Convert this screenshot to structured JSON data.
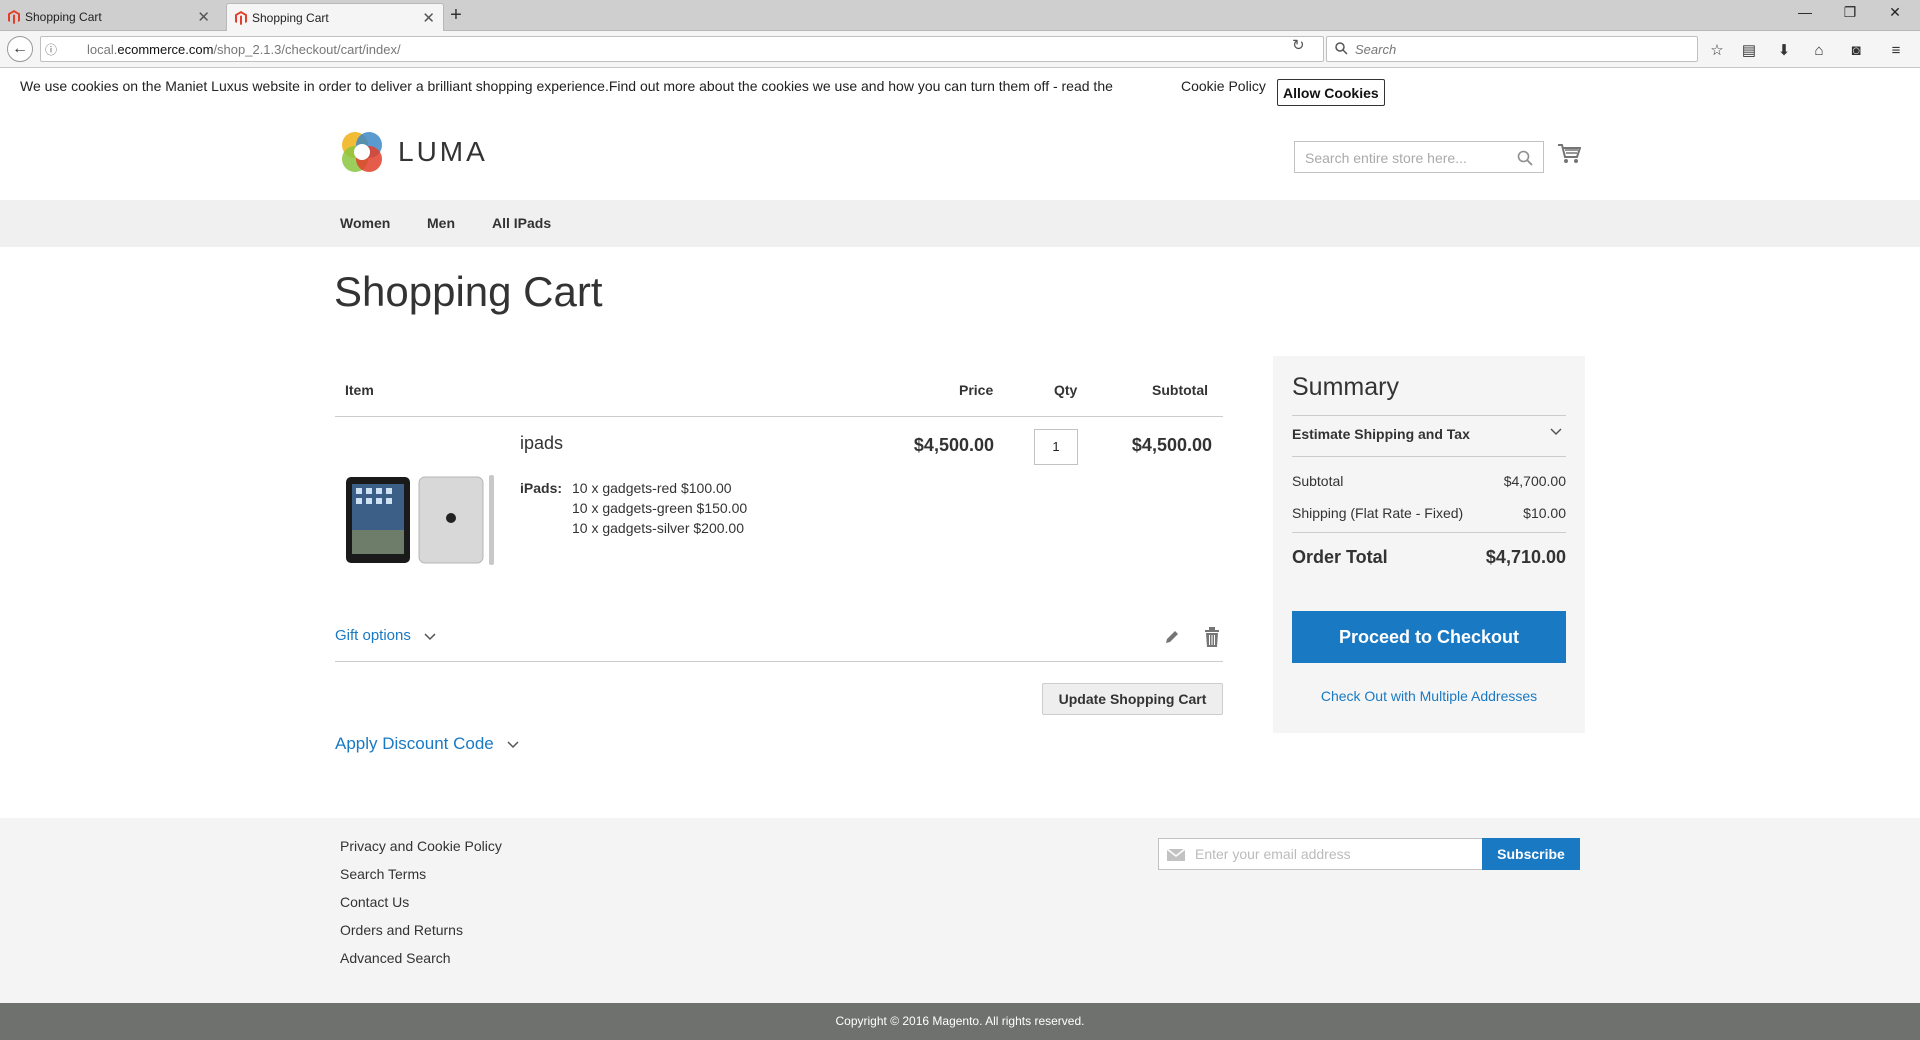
{
  "browser": {
    "tabs": [
      {
        "title": "Shopping Cart",
        "active": false
      },
      {
        "title": "Shopping Cart",
        "active": true
      }
    ],
    "url_prefix": "local.",
    "url_domain": "ecommerce.com",
    "url_path": "/shop_2.1.3/checkout/cart/index/",
    "search_placeholder": "Search"
  },
  "cookie": {
    "text": "We use cookies on the Maniet Luxus website in order to deliver a brilliant shopping experience.Find out more about the cookies we use and how you can turn them off - read the",
    "policy_link": "Cookie Policy",
    "allow_button": "Allow Cookies"
  },
  "header": {
    "logo_text": "LUMA",
    "search_placeholder": "Search entire store here..."
  },
  "nav": {
    "items": [
      "Women",
      "Men",
      "All IPads"
    ]
  },
  "page_title": "Shopping Cart",
  "cart": {
    "headers": {
      "item": "Item",
      "price": "Price",
      "qty": "Qty",
      "subtotal": "Subtotal"
    },
    "items": [
      {
        "name": "ipads",
        "option_label": "iPads:",
        "option_values": [
          "10 x gadgets-red $100.00",
          "10 x gadgets-green $150.00",
          "10 x gadgets-silver $200.00"
        ],
        "price": "$4,500.00",
        "qty": "1",
        "subtotal": "$4,500.00"
      }
    ],
    "gift_options": "Gift options",
    "update_button": "Update Shopping Cart",
    "discount": "Apply Discount Code"
  },
  "summary": {
    "title": "Summary",
    "estimate": "Estimate Shipping and Tax",
    "subtotal_label": "Subtotal",
    "subtotal_value": "$4,700.00",
    "shipping_label": "Shipping (Flat Rate - Fixed)",
    "shipping_value": "$10.00",
    "total_label": "Order Total",
    "total_value": "$4,710.00",
    "checkout_button": "Proceed to Checkout",
    "multi_link": "Check Out with Multiple Addresses"
  },
  "footer": {
    "links": [
      "Privacy and Cookie Policy",
      "Search Terms",
      "Contact Us",
      "Orders and Returns",
      "Advanced Search"
    ],
    "email_placeholder": "Enter your email address",
    "subscribe_button": "Subscribe",
    "copyright": "Copyright © 2016 Magento. All rights reserved."
  },
  "colors": {
    "accent": "#1979c3",
    "footer_bar": "#6e716e"
  }
}
